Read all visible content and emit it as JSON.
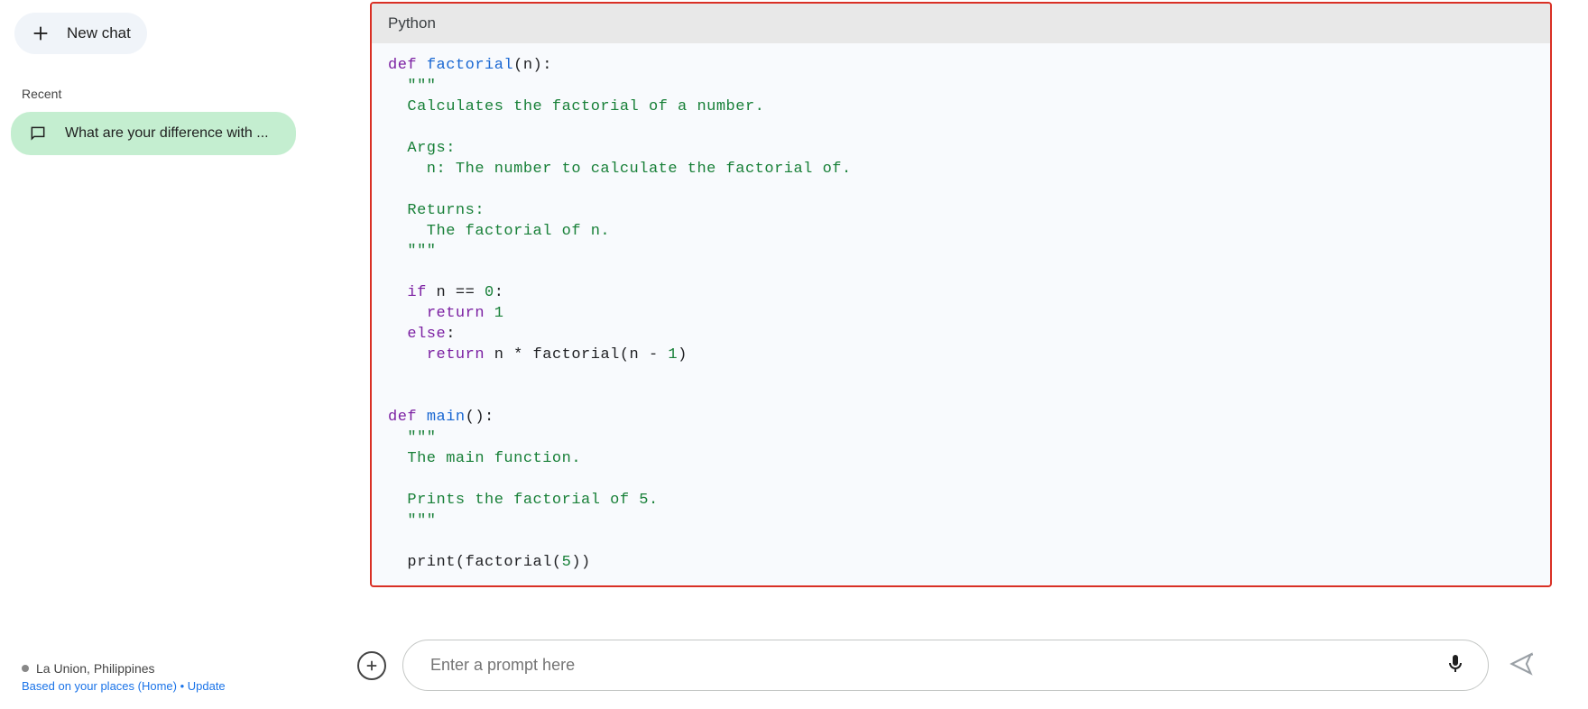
{
  "sidebar": {
    "new_chat_label": "New chat",
    "recent_label": "Recent",
    "items": [
      {
        "label": "What are your difference with ..."
      }
    ]
  },
  "footer": {
    "location": "La Union, Philippines",
    "subtext": "Based on your places (Home) • Update"
  },
  "code_block": {
    "language": "Python",
    "tokens": [
      {
        "t": "kw",
        "v": "def"
      },
      {
        "t": "",
        "v": " "
      },
      {
        "t": "fn",
        "v": "factorial"
      },
      {
        "t": "",
        "v": "(n):"
      },
      {
        "t": "nl",
        "v": "\n"
      },
      {
        "t": "",
        "v": "  "
      },
      {
        "t": "str",
        "v": "\"\"\""
      },
      {
        "t": "nl",
        "v": "\n"
      },
      {
        "t": "str",
        "v": "  Calculates the factorial of a number."
      },
      {
        "t": "nl",
        "v": "\n"
      },
      {
        "t": "nl",
        "v": "\n"
      },
      {
        "t": "str",
        "v": "  Args:"
      },
      {
        "t": "nl",
        "v": "\n"
      },
      {
        "t": "str",
        "v": "    n: The number to calculate the factorial of."
      },
      {
        "t": "nl",
        "v": "\n"
      },
      {
        "t": "nl",
        "v": "\n"
      },
      {
        "t": "str",
        "v": "  Returns:"
      },
      {
        "t": "nl",
        "v": "\n"
      },
      {
        "t": "str",
        "v": "    The factorial of n."
      },
      {
        "t": "nl",
        "v": "\n"
      },
      {
        "t": "",
        "v": "  "
      },
      {
        "t": "str",
        "v": "\"\"\""
      },
      {
        "t": "nl",
        "v": "\n"
      },
      {
        "t": "nl",
        "v": "\n"
      },
      {
        "t": "",
        "v": "  "
      },
      {
        "t": "kw",
        "v": "if"
      },
      {
        "t": "",
        "v": " n == "
      },
      {
        "t": "num",
        "v": "0"
      },
      {
        "t": "",
        "v": ":"
      },
      {
        "t": "nl",
        "v": "\n"
      },
      {
        "t": "",
        "v": "    "
      },
      {
        "t": "kw",
        "v": "return"
      },
      {
        "t": "",
        "v": " "
      },
      {
        "t": "num",
        "v": "1"
      },
      {
        "t": "nl",
        "v": "\n"
      },
      {
        "t": "",
        "v": "  "
      },
      {
        "t": "kw",
        "v": "else"
      },
      {
        "t": "",
        "v": ":"
      },
      {
        "t": "nl",
        "v": "\n"
      },
      {
        "t": "",
        "v": "    "
      },
      {
        "t": "kw",
        "v": "return"
      },
      {
        "t": "",
        "v": " n * factorial(n - "
      },
      {
        "t": "num",
        "v": "1"
      },
      {
        "t": "",
        "v": ")"
      },
      {
        "t": "nl",
        "v": "\n"
      },
      {
        "t": "nl",
        "v": "\n"
      },
      {
        "t": "nl",
        "v": "\n"
      },
      {
        "t": "kw",
        "v": "def"
      },
      {
        "t": "",
        "v": " "
      },
      {
        "t": "fn",
        "v": "main"
      },
      {
        "t": "",
        "v": "():"
      },
      {
        "t": "nl",
        "v": "\n"
      },
      {
        "t": "",
        "v": "  "
      },
      {
        "t": "str",
        "v": "\"\"\""
      },
      {
        "t": "nl",
        "v": "\n"
      },
      {
        "t": "str",
        "v": "  The main function."
      },
      {
        "t": "nl",
        "v": "\n"
      },
      {
        "t": "nl",
        "v": "\n"
      },
      {
        "t": "str",
        "v": "  Prints the factorial of 5."
      },
      {
        "t": "nl",
        "v": "\n"
      },
      {
        "t": "",
        "v": "  "
      },
      {
        "t": "str",
        "v": "\"\"\""
      },
      {
        "t": "nl",
        "v": "\n"
      },
      {
        "t": "nl",
        "v": "\n"
      },
      {
        "t": "",
        "v": "  print(factorial("
      },
      {
        "t": "num",
        "v": "5"
      },
      {
        "t": "",
        "v": "))"
      }
    ]
  },
  "composer": {
    "placeholder": "Enter a prompt here"
  },
  "colors": {
    "highlight_border": "#d93025",
    "active_chat_bg": "#c4eed0"
  }
}
